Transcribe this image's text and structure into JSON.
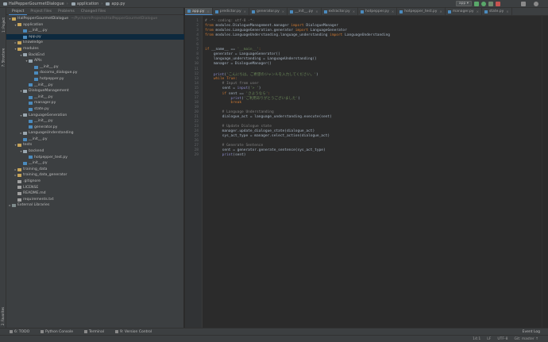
{
  "navbar": {
    "crumbs": [
      "HalPepperGourmetDialogue",
      "application",
      "app.py"
    ],
    "run_config": "app ▾"
  },
  "left_stripe": {
    "project_label": "1: Project",
    "structure_label": "7: Structure",
    "favorites_label": "2: Favorites"
  },
  "project_panel": {
    "tabs": [
      "Project",
      "Project Files",
      "Problems",
      "Changed Files"
    ],
    "tree": [
      {
        "depth": 0,
        "arrow": "▾",
        "icon": "folder",
        "label": "HalPepperGourmetDialogue",
        "hint": "~/PycharmProjects/HalPepperGourmetDialogue",
        "sel": false
      },
      {
        "depth": 1,
        "arrow": "▾",
        "icon": "folder",
        "label": "application",
        "hint": "",
        "sel": false
      },
      {
        "depth": 2,
        "arrow": "",
        "icon": "pyf",
        "label": "__init__.py",
        "hint": "",
        "sel": false
      },
      {
        "depth": 2,
        "arrow": "",
        "icon": "pyf",
        "label": "app.py",
        "hint": "",
        "sel": true
      },
      {
        "depth": 1,
        "arrow": "▸",
        "icon": "folder",
        "label": "knowledge",
        "hint": "",
        "sel": false
      },
      {
        "depth": 1,
        "arrow": "▾",
        "icon": "folder",
        "label": "modules",
        "hint": "",
        "sel": false
      },
      {
        "depth": 2,
        "arrow": "▾",
        "icon": "pkg",
        "label": "BackEnd",
        "hint": "",
        "sel": false
      },
      {
        "depth": 3,
        "arrow": "▾",
        "icon": "pkg",
        "label": "APIs",
        "hint": "",
        "sel": false
      },
      {
        "depth": 4,
        "arrow": "",
        "icon": "pyf",
        "label": "__init__.py",
        "hint": "",
        "sel": false
      },
      {
        "depth": 4,
        "arrow": "",
        "icon": "pyf",
        "label": "docomo_dialogue.py",
        "hint": "",
        "sel": false
      },
      {
        "depth": 4,
        "arrow": "",
        "icon": "pyf",
        "label": "hotpepper.py",
        "hint": "",
        "sel": false
      },
      {
        "depth": 3,
        "arrow": "",
        "icon": "pyf",
        "label": "__init__.py",
        "hint": "",
        "sel": false
      },
      {
        "depth": 2,
        "arrow": "▾",
        "icon": "pkg",
        "label": "DialogueManagement",
        "hint": "",
        "sel": false
      },
      {
        "depth": 3,
        "arrow": "",
        "icon": "pyf",
        "label": "__init__.py",
        "hint": "",
        "sel": false
      },
      {
        "depth": 3,
        "arrow": "",
        "icon": "pyf",
        "label": "manager.py",
        "hint": "",
        "sel": false
      },
      {
        "depth": 3,
        "arrow": "",
        "icon": "pyf",
        "label": "state.py",
        "hint": "",
        "sel": false
      },
      {
        "depth": 2,
        "arrow": "▾",
        "icon": "pkg",
        "label": "LanguageGeneration",
        "hint": "",
        "sel": false
      },
      {
        "depth": 3,
        "arrow": "",
        "icon": "pyf",
        "label": "__init__.py",
        "hint": "",
        "sel": false
      },
      {
        "depth": 3,
        "arrow": "",
        "icon": "pyf",
        "label": "generator.py",
        "hint": "",
        "sel": false
      },
      {
        "depth": 2,
        "arrow": "▸",
        "icon": "pkg",
        "label": "LanguageUnderstanding",
        "hint": "",
        "sel": false
      },
      {
        "depth": 2,
        "arrow": "",
        "icon": "pyf",
        "label": "__init__.py",
        "hint": "",
        "sel": false
      },
      {
        "depth": 1,
        "arrow": "▾",
        "icon": "folder",
        "label": "tests",
        "hint": "",
        "sel": false
      },
      {
        "depth": 2,
        "arrow": "▾",
        "icon": "pkg",
        "label": "backend",
        "hint": "",
        "sel": false
      },
      {
        "depth": 3,
        "arrow": "",
        "icon": "pyf",
        "label": "hotpepper_test.py",
        "hint": "",
        "sel": false
      },
      {
        "depth": 2,
        "arrow": "",
        "icon": "pyf",
        "label": "__init__.py",
        "hint": "",
        "sel": false
      },
      {
        "depth": 1,
        "arrow": "▸",
        "icon": "folder",
        "label": "training_data",
        "hint": "",
        "sel": false
      },
      {
        "depth": 1,
        "arrow": "▸",
        "icon": "folder",
        "label": "training_data_generator",
        "hint": "",
        "sel": false
      },
      {
        "depth": 1,
        "arrow": "",
        "icon": "txt",
        "label": ".gitignore",
        "hint": "",
        "sel": false
      },
      {
        "depth": 1,
        "arrow": "",
        "icon": "txt",
        "label": "LICENSE",
        "hint": "",
        "sel": false
      },
      {
        "depth": 1,
        "arrow": "",
        "icon": "txt",
        "label": "README.md",
        "hint": "",
        "sel": false
      },
      {
        "depth": 1,
        "arrow": "",
        "icon": "txt",
        "label": "requirements.txt",
        "hint": "",
        "sel": false
      },
      {
        "depth": 0,
        "arrow": "▸",
        "icon": "lib",
        "label": "External Libraries",
        "hint": "",
        "sel": false
      }
    ]
  },
  "editor": {
    "tabs": [
      {
        "label": "app.py",
        "active": true
      },
      {
        "label": "predictor.py",
        "active": false
      },
      {
        "label": "generator.py",
        "active": false
      },
      {
        "label": "__init__.py",
        "active": false
      },
      {
        "label": "extractor.py",
        "active": false
      },
      {
        "label": "hotpepper.py",
        "active": false
      },
      {
        "label": "hotpepper_test.py",
        "active": false
      },
      {
        "label": "manager.py",
        "active": false
      },
      {
        "label": "state.py",
        "active": false
      }
    ],
    "lines": [
      [
        [
          "# -*- coding: utf-8 -*-",
          "#808080"
        ]
      ],
      [
        [
          "from ",
          "#cc7832"
        ],
        [
          "modules.DialogueManagement.manager ",
          "#a9b7c6"
        ],
        [
          "import ",
          "#cc7832"
        ],
        [
          "DialogueManager",
          "#a9b7c6"
        ]
      ],
      [
        [
          "from ",
          "#cc7832"
        ],
        [
          "modules.LanguageGeneration.generator ",
          "#a9b7c6"
        ],
        [
          "import ",
          "#cc7832"
        ],
        [
          "LanguageGenerator",
          "#a9b7c6"
        ]
      ],
      [
        [
          "from ",
          "#cc7832"
        ],
        [
          "modules.LanguageUnderstanding.language_understanding ",
          "#a9b7c6"
        ],
        [
          "import ",
          "#cc7832"
        ],
        [
          "LanguageUnderstanding",
          "#a9b7c6"
        ]
      ],
      [],
      [],
      [
        [
          "if ",
          "#cc7832"
        ],
        [
          "__name__ == ",
          "#a9b7c6"
        ],
        [
          "'__main__'",
          "#6a8759"
        ],
        [
          ":",
          "#cc7832"
        ]
      ],
      [
        [
          "    generator = LanguageGenerator()",
          "#a9b7c6"
        ]
      ],
      [
        [
          "    language_understanding = LanguageUnderstanding()",
          "#a9b7c6"
        ]
      ],
      [
        [
          "    manager = DialogueManager()",
          "#a9b7c6"
        ]
      ],
      [],
      [
        [
          "    print",
          "#8888c6"
        ],
        [
          "(",
          "#a9b7c6"
        ],
        [
          "'こんにちは。ご希望のジャンルを入力してください。'",
          "#6a8759"
        ],
        [
          ")",
          "#a9b7c6"
        ]
      ],
      [
        [
          "    while ",
          "#cc7832"
        ],
        [
          "True",
          "#cc7832"
        ],
        [
          ":",
          "#cc7832"
        ]
      ],
      [
        [
          "        # Input from user",
          "#808080"
        ]
      ],
      [
        [
          "        sent = ",
          "#a9b7c6"
        ],
        [
          "input",
          "#8888c6"
        ],
        [
          "(",
          "#a9b7c6"
        ],
        [
          "'> '",
          "#6a8759"
        ],
        [
          ")",
          "#a9b7c6"
        ]
      ],
      [
        [
          "        if ",
          "#cc7832"
        ],
        [
          "sent == ",
          "#a9b7c6"
        ],
        [
          "'さようなら'",
          "#6a8759"
        ],
        [
          ":",
          "#cc7832"
        ]
      ],
      [
        [
          "            print",
          "#8888c6"
        ],
        [
          "(",
          "#a9b7c6"
        ],
        [
          "'ご利用ありがとうございました'",
          "#6a8759"
        ],
        [
          ")",
          "#a9b7c6"
        ]
      ],
      [
        [
          "            break",
          "#cc7832"
        ]
      ],
      [],
      [
        [
          "        # Language Understanding",
          "#808080"
        ]
      ],
      [
        [
          "        dialogue_act = language_understanding.execute(sent)",
          "#a9b7c6"
        ]
      ],
      [],
      [
        [
          "        # Update Dialogue state",
          "#808080"
        ]
      ],
      [
        [
          "        manager.update_dialogue_state(dialogue_act)",
          "#a9b7c6"
        ]
      ],
      [
        [
          "        sys_act_type = manager.select_action(dialogue_act)",
          "#a9b7c6"
        ]
      ],
      [],
      [
        [
          "        # Generate Sentence",
          "#808080"
        ]
      ],
      [
        [
          "        sent = generator.generate_sentence(sys_act_type)",
          "#a9b7c6"
        ]
      ],
      [
        [
          "        print",
          "#8888c6"
        ],
        [
          "(sent)",
          "#a9b7c6"
        ]
      ]
    ]
  },
  "bottom_tools": [
    "6: TODO",
    "Python Console",
    "Terminal",
    "9: Version Control"
  ],
  "event_log": "Event Log",
  "status": [
    "14:1",
    "LF",
    "UTF-8",
    "Git: master ↑"
  ],
  "colors": {
    "accent": "#4a88c7",
    "background": "#2b2b2b",
    "panel": "#3c3f41"
  }
}
